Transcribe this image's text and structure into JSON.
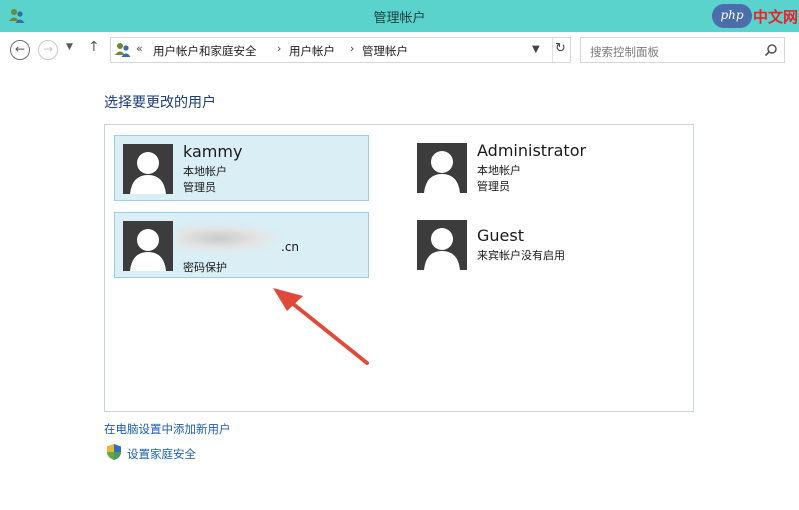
{
  "window": {
    "title": "管理帐户",
    "watermark_logo": "php",
    "watermark_text": "中文网"
  },
  "nav": {
    "back_icon": "back-arrow-icon",
    "forward_icon": "forward-arrow-icon",
    "recent_icon": "chevron-down-icon",
    "up_icon": "up-arrow-icon"
  },
  "address": {
    "overflow": "«",
    "breadcrumbs": [
      "用户帐户和家庭安全",
      "用户帐户",
      "管理帐户"
    ],
    "separator": "›",
    "refresh_icon": "refresh-icon"
  },
  "search": {
    "placeholder": "搜索控制面板"
  },
  "main": {
    "heading": "选择要更改的用户",
    "accounts": [
      {
        "name": "kammy",
        "lines": [
          "本地帐户",
          "管理员"
        ],
        "selected": true
      },
      {
        "name": "Administrator",
        "lines": [
          "本地帐户",
          "管理员"
        ],
        "selected": false
      },
      {
        "name": ".cn",
        "lines": [
          "密码保护"
        ],
        "selected": true
      },
      {
        "name": "Guest",
        "lines": [
          "来宾帐户没有启用"
        ],
        "selected": false
      }
    ]
  },
  "links": {
    "add_user": "在电脑设置中添加新用户",
    "family_safety": "设置家庭安全"
  },
  "colors": {
    "titlebar": "#5ad3cc",
    "selected_tile": "#d9eff5",
    "link": "#1c5eb4",
    "heading": "#1c3c7c",
    "annotation_arrow": "#e04a3a"
  }
}
